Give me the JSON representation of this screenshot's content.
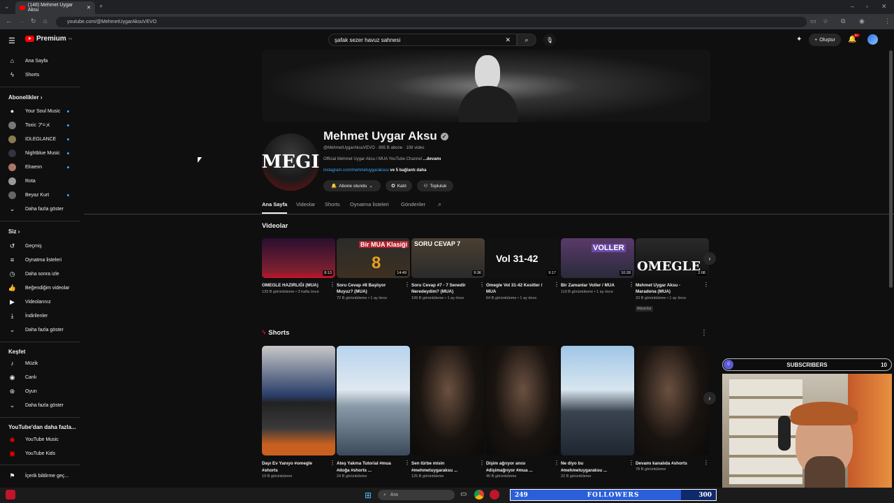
{
  "browser": {
    "tab_title": "(148) Mehmet Uygar Aksu",
    "url": "youtube.com/@MehmetUygarAksuVEVO"
  },
  "header": {
    "logo": "Premium",
    "logo_sup": "TR",
    "search_value": "şafak sezer havuz sahnesi",
    "create_label": "Oluştur",
    "notif_badge": "9+"
  },
  "sidebar": {
    "home": "Ana Sayfa",
    "shorts": "Shorts",
    "subs_header": "Abonelikler",
    "subs": [
      "Your Soul Music",
      "Toxic ア=メ",
      "IDLEGLANCE",
      "Nightblue Music",
      "Elraenn",
      "Rota",
      "Beyaz Kurt"
    ],
    "subs_more": "Daha fazla göster",
    "you_header": "Siz",
    "you": [
      "Geçmiş",
      "Oynatma listeleri",
      "Daha sonra izle",
      "Beğendiğim videolar",
      "Videolarınız",
      "İndirilenler"
    ],
    "you_more": "Daha fazla göster",
    "explore_header": "Keşfet",
    "explore": [
      "Müzik",
      "Canlı",
      "Oyun"
    ],
    "explore_more": "Daha fazla göster",
    "more_header": "YouTube'dan daha fazla...",
    "more": [
      "YouTube Music",
      "YouTube Kids"
    ],
    "report": "İçerik bildirme geç..."
  },
  "channel": {
    "avatar_text": "MEGI",
    "name": "Mehmet Uygar Aksu",
    "meta": "@MehmetUygarAksuVEVO · 865 B abone · 108 video",
    "desc": "Official Mehmet Uygar Aksu / MUA YouTube Channel",
    "desc_more": "...devamı",
    "link": "instagram.com/mehmetuygaraksuu",
    "link_more": "ve 5 bağlantı daha",
    "subscribed": "Abone olundu",
    "join": "Katıl",
    "community": "Topluluk",
    "tabs": [
      "Ana Sayfa",
      "Videolar",
      "Shorts",
      "Oynatma listeleri",
      "Gönderiler"
    ]
  },
  "videos_section": {
    "title": "Videolar",
    "items": [
      {
        "title": "OMEGLE HAZIRLIĞI (MUA)",
        "meta": "133 B görüntüleme • 3 hafta önce",
        "duration": "8:13",
        "thumb_text": ""
      },
      {
        "title": "Soru Cevap #8 Başlıyor Muyuz? (MUA)",
        "meta": "72 B görüntüleme • 1 ay önce",
        "duration": "14:49",
        "thumb_text": "Bir MUA Klasiği"
      },
      {
        "title": "Soru Cevap #7 - 7 Senedir Neredeydim? (MUA)",
        "meta": "199 B görüntüleme • 1 ay önce",
        "duration": "9:36",
        "thumb_text": "SORU CEVAP 7"
      },
      {
        "title": "Omegle Vol 31-42 Kesitler / MUA",
        "meta": "64 B görüntüleme • 1 ay önce",
        "duration": "9:17",
        "thumb_text": "Vol 31-42"
      },
      {
        "title": "Bir Zamanlar Voller / MUA",
        "meta": "110 B görüntüleme • 1 ay önce",
        "duration": "10:28",
        "thumb_text": "VOLLER"
      },
      {
        "title": "Mehmet Uygar Aksu - Maradona (MUA)",
        "meta": "33 B görüntüleme • 1 ay önce",
        "duration": "2:08",
        "thumb_text": "OMEGLE",
        "badge": "Altyazılar"
      }
    ]
  },
  "shorts_section": {
    "title": "Shorts",
    "items": [
      {
        "title": "Dayı Ev Yanıyo #omegle #shorts",
        "meta": "19 B görüntüleme"
      },
      {
        "title": "Ateş Yakma Tutorial #mua #doğa #shorts ...",
        "meta": "24 B görüntüleme"
      },
      {
        "title": "Sen türbe misin #mehmetuygaraksu ...",
        "meta": "125 B görüntüleme"
      },
      {
        "title": "Dişim ağrıyor anısı #dişimağrıyor #mua ...",
        "meta": "40 B görüntüleme"
      },
      {
        "title": "Ne diyo bu #mehmetuygaraksu ...",
        "meta": "22 B görüntüleme"
      },
      {
        "title": "Devamı kanalıda #shorts",
        "meta": "78 B görüntüleme"
      }
    ]
  },
  "overlay": {
    "subs_label": "SUBSCRIBERS",
    "subs_left": "0",
    "subs_right": "10",
    "followers_label": "FOLLOWERS",
    "followers_left": "249",
    "followers_right": "300",
    "followers_progress": 0.83
  },
  "taskbar": {
    "search_placeholder": "Ara"
  }
}
